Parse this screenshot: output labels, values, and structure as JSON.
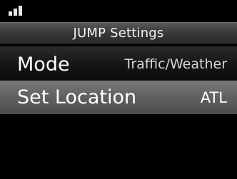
{
  "status": {
    "signal_icon": "signal-strength-icon"
  },
  "header": {
    "title": "JUMP Settings"
  },
  "menu": {
    "items": [
      {
        "label": "Mode",
        "value": "Traffic/Weather",
        "selected": false
      },
      {
        "label": "Set Location",
        "value": "ATL",
        "selected": true
      }
    ]
  },
  "colors": {
    "background": "#000000",
    "title_bar": "#3a3a3a",
    "selected_row": "#626262",
    "text": "#ffffff"
  }
}
